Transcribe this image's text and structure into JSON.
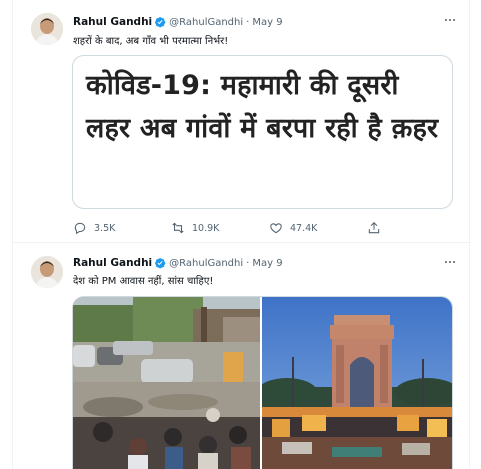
{
  "tweets": [
    {
      "author_name": "Rahul Gandhi",
      "handle": "@RahulGandhi",
      "separator": "·",
      "date": "May 9",
      "text": "शहरों के बाद, अब गाँव भी परमात्मा निर्भर!",
      "card_title": "कोविड-19: महामारी की दूसरी लहर अब गांवों में बरपा रही है क़हर",
      "reply_count": "3.5K",
      "retweet_count": "10.9K",
      "like_count": "47.4K"
    },
    {
      "author_name": "Rahul Gandhi",
      "handle": "@RahulGandhi",
      "separator": "·",
      "date": "May 9",
      "text": "देश को PM आवास नहीं, सांस चाहिए!"
    }
  ],
  "icons": {
    "verified": "verified-badge-icon",
    "more": "more-options-icon",
    "reply": "reply-icon",
    "retweet": "retweet-icon",
    "like": "like-icon",
    "share": "share-icon"
  },
  "colors": {
    "verified_blue": "#1d9bf0",
    "secondary_text": "#536471",
    "border": "#cfd9de"
  }
}
